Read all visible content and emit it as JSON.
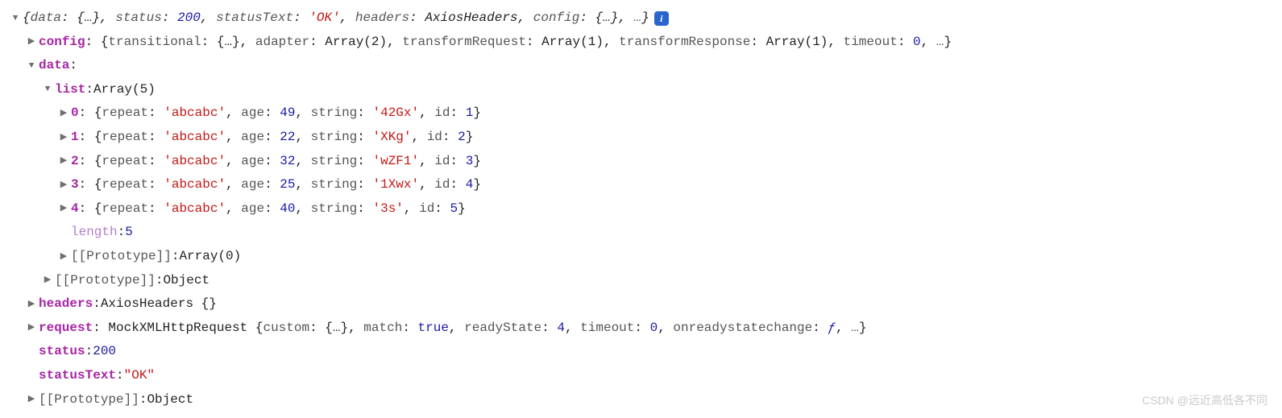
{
  "root": {
    "summary_open": "{",
    "summary_parts": [
      {
        "k": "data",
        "v": "{…}",
        "t": "punct"
      },
      {
        "k": "status",
        "v": "200",
        "t": "num"
      },
      {
        "k": "statusText",
        "v": "'OK'",
        "t": "str"
      },
      {
        "k": "headers",
        "v": "AxiosHeaders",
        "t": "text"
      },
      {
        "k": "config",
        "v": "{…}",
        "t": "punct"
      },
      {
        "k": "…",
        "v": "",
        "t": "ellipsis"
      }
    ],
    "summary_close": "}"
  },
  "config": {
    "key": "config",
    "open": "{",
    "parts": [
      {
        "k": "transitional",
        "v": "{…}",
        "t": "punct"
      },
      {
        "k": "adapter",
        "v": "Array(2)",
        "t": "text"
      },
      {
        "k": "transformRequest",
        "v": "Array(1)",
        "t": "text"
      },
      {
        "k": "transformResponse",
        "v": "Array(1)",
        "t": "text"
      },
      {
        "k": "timeout",
        "v": "0",
        "t": "num"
      },
      {
        "k": "…",
        "v": "",
        "t": "ellipsis"
      }
    ],
    "close": "}"
  },
  "data_key": "data",
  "list": {
    "key": "list",
    "type": "Array(5)",
    "items": [
      {
        "idx": "0",
        "repeat": "'abcabc'",
        "age": "49",
        "string": "'42Gx'",
        "id": "1"
      },
      {
        "idx": "1",
        "repeat": "'abcabc'",
        "age": "22",
        "string": "'XKg'",
        "id": "2"
      },
      {
        "idx": "2",
        "repeat": "'abcabc'",
        "age": "32",
        "string": "'wZF1'",
        "id": "3"
      },
      {
        "idx": "3",
        "repeat": "'abcabc'",
        "age": "25",
        "string": "'1Xwx'",
        "id": "4"
      },
      {
        "idx": "4",
        "repeat": "'abcabc'",
        "age": "40",
        "string": "'3s'",
        "id": "5"
      }
    ],
    "length_key": "length",
    "length_val": "5",
    "proto_key": "[[Prototype]]",
    "proto_val": "Array(0)"
  },
  "data_proto_key": "[[Prototype]]",
  "data_proto_val": "Object",
  "headers": {
    "key": "headers",
    "val": "AxiosHeaders {}"
  },
  "request": {
    "key": "request",
    "prefix": "MockXMLHttpRequest",
    "open": "{",
    "parts": [
      {
        "k": "custom",
        "v": "{…}",
        "t": "punct"
      },
      {
        "k": "match",
        "v": "true",
        "t": "bool"
      },
      {
        "k": "readyState",
        "v": "4",
        "t": "num"
      },
      {
        "k": "timeout",
        "v": "0",
        "t": "num"
      },
      {
        "k": "onreadystatechange",
        "v": "ƒ",
        "t": "func"
      },
      {
        "k": "…",
        "v": "",
        "t": "ellipsis"
      }
    ],
    "close": "}"
  },
  "status": {
    "key": "status",
    "val": "200"
  },
  "statusText": {
    "key": "statusText",
    "val": "\"OK\""
  },
  "root_proto_key": "[[Prototype]]",
  "root_proto_val": "Object",
  "labels": {
    "repeat": "repeat",
    "age": "age",
    "string": "string",
    "id": "id"
  },
  "watermark": "CSDN @远近高低各不同"
}
